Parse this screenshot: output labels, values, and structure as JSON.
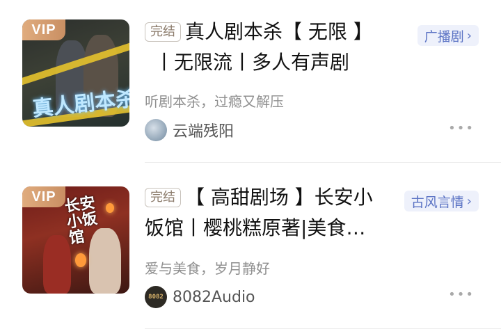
{
  "items": [
    {
      "vip_label": "VIP",
      "cover_text": "真人剧本杀",
      "status": "完结",
      "title_line1": "真人剧本杀【 无限 】",
      "title_line2": "丨无限流丨多人有声剧",
      "category": "广播剧",
      "subtitle": "听剧本杀，过瘾又解压",
      "author": "云端残阳",
      "more": "•••"
    },
    {
      "vip_label": "VIP",
      "cover_text": "长安小饭馆",
      "status": "完结",
      "title_line1": "【 高甜剧场 】长安小",
      "title_line2": "饭馆丨樱桃糕原著|美食…",
      "category": "古风言情",
      "subtitle": "爱与美食，岁月静好",
      "author": "8082Audio",
      "avatar_text": "8082",
      "more": "•••"
    }
  ],
  "colors": {
    "tag_text": "#5b73c4",
    "tag_bg": "#eef1fb",
    "vip_bg": "#d49c6f",
    "subtitle": "#8f8f8f"
  },
  "icons": {
    "chevron": "chevron-right-icon",
    "more": "more-dots-icon"
  }
}
